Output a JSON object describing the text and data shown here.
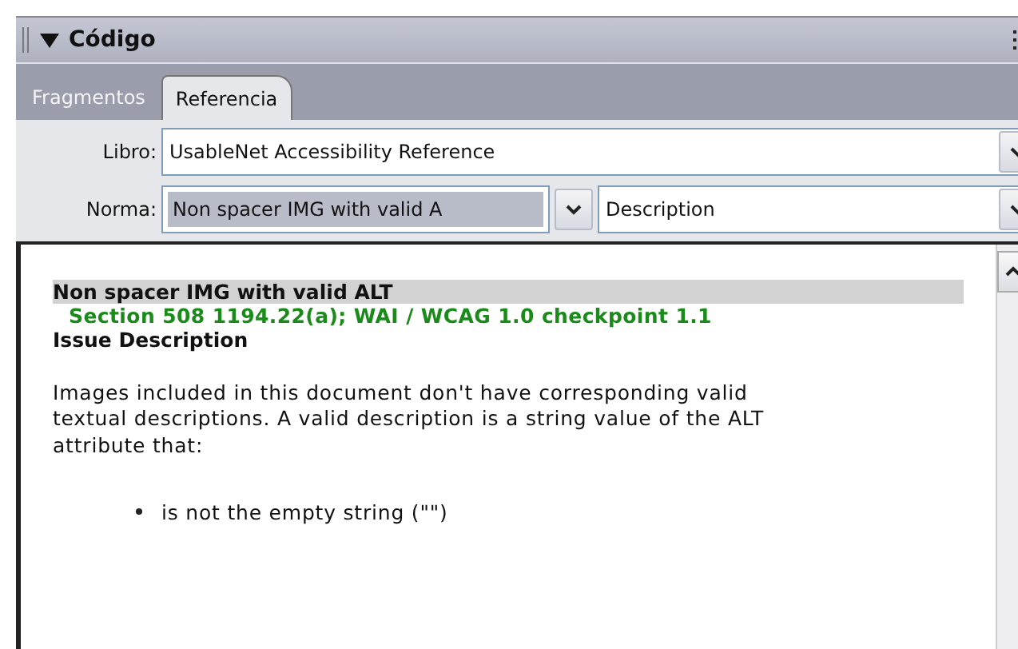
{
  "panel": {
    "title": "Código",
    "expanded": true
  },
  "tabs": [
    {
      "label": "Fragmentos",
      "selected": false
    },
    {
      "label": "Referencia",
      "selected": true
    }
  ],
  "book": {
    "label": "Libro:",
    "value": "UsableNet Accessibility Reference"
  },
  "rule": {
    "label": "Norma:",
    "value": "Non spacer IMG with valid A",
    "section_value": "Description"
  },
  "content": {
    "heading": "Non spacer IMG with valid ALT",
    "reference": "Section 508 1194.22(a); WAI / WCAG 1.0 checkpoint 1.1",
    "subheading": "Issue Description",
    "paragraph": "Images included in this document don't have corresponding valid textual descriptions. A valid description is a string value of the ALT attribute that:",
    "bullets": [
      "is not the empty string (\"\")"
    ]
  }
}
